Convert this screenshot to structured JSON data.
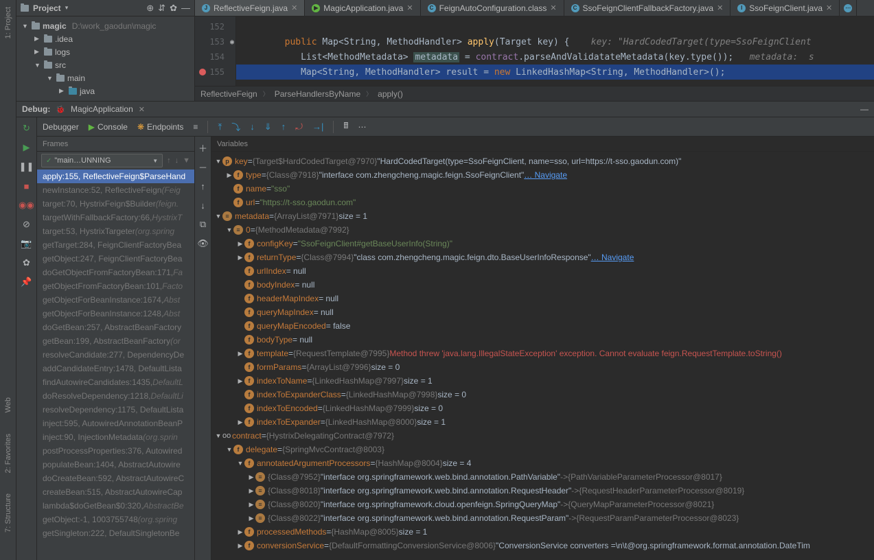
{
  "leftRail": [
    "1: Project",
    "Web",
    "2: Favorites",
    "7: Structure"
  ],
  "project": {
    "title": "Project",
    "root": "magic",
    "rootPath": "D:\\work_gaodun\\magic",
    "nodes": [
      ".idea",
      "logs",
      "src",
      "main",
      "java"
    ]
  },
  "tabs": [
    {
      "label": "ReflectiveFeign.java",
      "active": true,
      "icon": "j"
    },
    {
      "label": "MagicApplication.java",
      "active": false,
      "icon": "j"
    },
    {
      "label": "FeignAutoConfiguration.class",
      "active": false,
      "icon": "j"
    },
    {
      "label": "SsoFeignClientFallbackFactory.java",
      "active": false,
      "icon": "j"
    },
    {
      "label": "SsoFeignClient.java",
      "active": false,
      "icon": "j"
    }
  ],
  "code": {
    "lines": [
      "152",
      "153",
      "154",
      "155"
    ],
    "l153a": "        public",
    "l153b": " Map<String, MethodHandler> ",
    "l153c": "apply",
    "l153d": "(Target key) {    ",
    "l153e": "key: \"HardCodedTarget(type=SsoFeignClient",
    "l154a": "           List<MethodMetadata> ",
    "l154b": "metadata",
    "l154c": " = ",
    "l154d": "contract",
    "l154e": ".parseAndValidatateMetadata(key.type());   ",
    "l154f": "metadata:  s",
    "l155a": "           Map<String, MethodHandler> result = ",
    "l155b": "new",
    "l155c": " LinkedHashMap<String, MethodHandler>();"
  },
  "breadcrumb": [
    "ReflectiveFeign",
    "ParseHandlersByName",
    "apply()"
  ],
  "debug": {
    "title": "Debug:",
    "session": "MagicApplication",
    "tabs": [
      "Debugger",
      "Console",
      "Endpoints"
    ],
    "framesTitle": "Frames",
    "varsTitle": "Variables",
    "thread": "\"main…UNNING"
  },
  "frames": [
    {
      "t": "apply:155, ReflectiveFeign$ParseHand",
      "sel": true
    },
    {
      "t": "newInstance:52, ReflectiveFeign ",
      "loc": "(Feig"
    },
    {
      "t": "target:70, HystrixFeign$Builder ",
      "loc": "(feign."
    },
    {
      "t": "targetWithFallbackFactory:66, ",
      "loc": "HystrixT"
    },
    {
      "t": "target:53, HystrixTargeter ",
      "loc": "(org.spring"
    },
    {
      "t": "getTarget:284, FeignClientFactoryBea"
    },
    {
      "t": "getObject:247, FeignClientFactoryBea"
    },
    {
      "t": "doGetObjectFromFactoryBean:171, ",
      "loc": "Fa"
    },
    {
      "t": "getObjectFromFactoryBean:101, ",
      "loc": "Facto"
    },
    {
      "t": "getObjectForBeanInstance:1674, ",
      "loc": "Abst"
    },
    {
      "t": "getObjectForBeanInstance:1248, ",
      "loc": "Abst"
    },
    {
      "t": "doGetBean:257, AbstractBeanFactory"
    },
    {
      "t": "getBean:199, AbstractBeanFactory ",
      "loc": "(or"
    },
    {
      "t": "resolveCandidate:277, DependencyDe"
    },
    {
      "t": "addCandidateEntry:1478, DefaultLista"
    },
    {
      "t": "findAutowireCandidates:1435, ",
      "loc": "DefaultL"
    },
    {
      "t": "doResolveDependency:1218, ",
      "loc": "DefaultLi"
    },
    {
      "t": "resolveDependency:1175, DefaultLista"
    },
    {
      "t": "inject:595, AutowiredAnnotationBeanP"
    },
    {
      "t": "inject:90, InjectionMetadata ",
      "loc": "(org.sprin"
    },
    {
      "t": "postProcessProperties:376, Autowired"
    },
    {
      "t": "populateBean:1404, AbstractAutowire"
    },
    {
      "t": "doCreateBean:592, AbstractAutowireC"
    },
    {
      "t": "createBean:515, AbstractAutowireCap"
    },
    {
      "t": "lambda$doGetBean$0:320, ",
      "loc": "AbstractBe"
    },
    {
      "t": "getObject:-1, 1003755748 ",
      "loc": "(org.spring"
    },
    {
      "t": "getSingleton:222, DefaultSingletonBe"
    }
  ],
  "vars": {
    "keyVal": "\"HardCodedTarget(type=SsoFeignClient, name=sso, url=https://t-sso.gaodun.com)\"",
    "keyObj": "{Target$HardCodedTarget@7970}",
    "typeObj": "{Class@7918}",
    "typeVal": "\"interface com.zhengcheng.magic.feign.SsoFeignClient\"",
    "nameVal": "\"sso\"",
    "urlVal": "\"https://t-sso.gaodun.com\"",
    "metaObj": "{ArrayList@7971}",
    "metaSize": " size = 1",
    "meta0Obj": "{MethodMetadata@7992}",
    "configKeyVal": "\"SsoFeignClient#getBaseUserInfo(String)\"",
    "retObj": "{Class@7994}",
    "retVal": "\"class com.zhengcheng.magic.feign.dto.BaseUserInfoResponse\"",
    "urlIndex": " = null",
    "bodyIndex": " = null",
    "headerMapIndex": " = null",
    "queryMapIndex": " = null",
    "queryMapEncoded": " = false",
    "bodyType": " = null",
    "templateObj": "{RequestTemplate@7995}",
    "templateErr": "Method threw 'java.lang.IllegalStateException' exception. Cannot evaluate feign.RequestTemplate.toString()",
    "formParamsObj": "{ArrayList@7996}",
    "formParamsSize": " size = 0",
    "idxNameObj": "{LinkedHashMap@7997}",
    "idxNameSize": " size = 1",
    "idxExpClsObj": "{LinkedHashMap@7998}",
    "idxExpClsSize": " size = 0",
    "idxEncObj": "{LinkedHashMap@7999}",
    "idxEncSize": " size = 0",
    "idxExpObj": "{LinkedHashMap@8000}",
    "idxExpSize": " size = 1",
    "contractObj": "{HystrixDelegatingContract@7972}",
    "delegateObj": "{SpringMvcContract@8003}",
    "aapObj": "{HashMap@8004}",
    "aapSize": " size = 4",
    "aap0Key": "{Class@7952}",
    "aap0Val": "\"interface org.springframework.web.bind.annotation.PathVariable\"",
    "aap0Map": "{PathVariableParameterProcessor@8017}",
    "aap1Key": "{Class@8018}",
    "aap1Val": "\"interface org.springframework.web.bind.annotation.RequestHeader\"",
    "aap1Map": "{RequestHeaderParameterProcessor@8019}",
    "aap2Key": "{Class@8020}",
    "aap2Val": "\"interface org.springframework.cloud.openfeign.SpringQueryMap\"",
    "aap2Map": "{QueryMapParameterProcessor@8021}",
    "aap3Key": "{Class@8022}",
    "aap3Val": "\"interface org.springframework.web.bind.annotation.RequestParam\"",
    "aap3Map": "{RequestParamParameterProcessor@8023}",
    "pmObj": "{HashMap@8005}",
    "pmSize": " size = 1",
    "csObj": "{DefaultFormattingConversionService@8006}",
    "csVal": "\"ConversionService converters =\\n\\t@org.springframework.format.annotation.DateTim",
    "navigate": "… Navigate"
  }
}
